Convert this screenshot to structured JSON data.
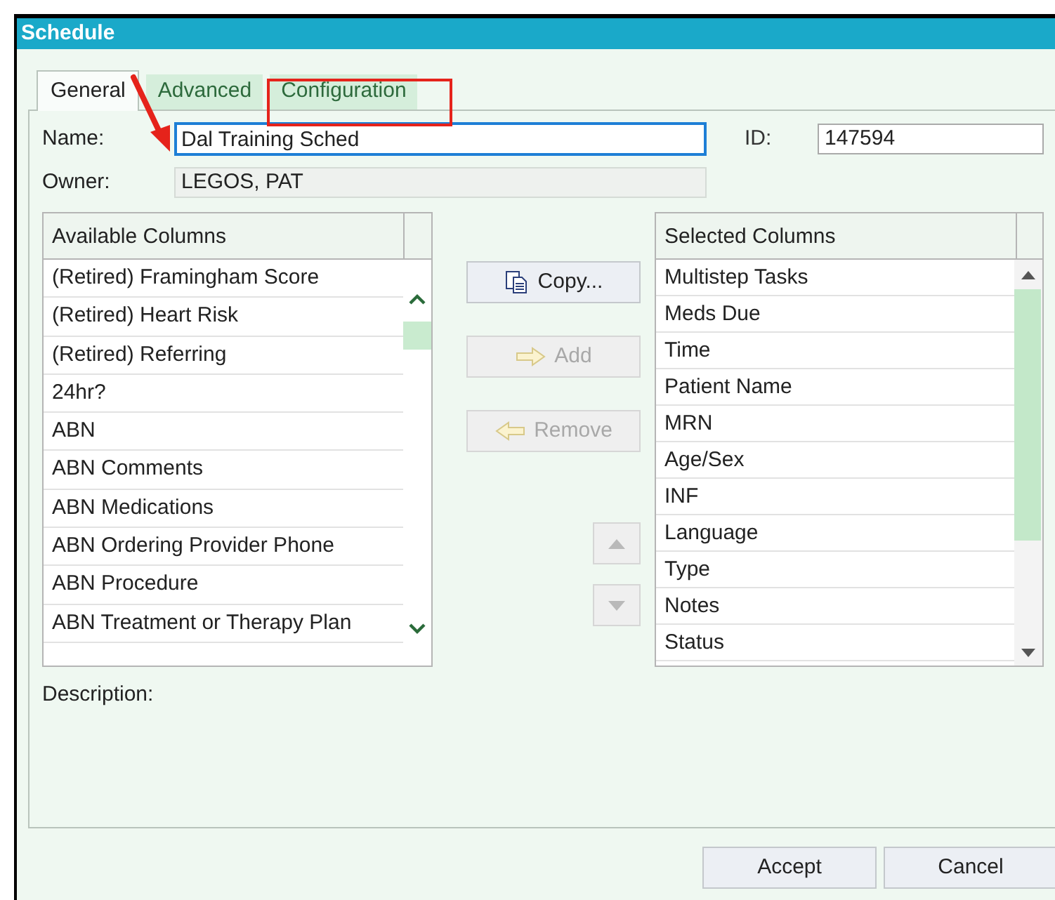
{
  "window": {
    "title": "Schedule"
  },
  "tabs": [
    {
      "label": "General",
      "selected": true
    },
    {
      "label": "Advanced",
      "selected": false
    },
    {
      "label": "Configuration",
      "selected": false
    }
  ],
  "name": {
    "label": "Name:",
    "value": "Dal Training Sched",
    "focused": true
  },
  "id": {
    "label": "ID:",
    "value": "147594"
  },
  "owner": {
    "label": "Owner:",
    "value": "LEGOS, PAT"
  },
  "available_columns": {
    "header": "Available Columns",
    "items": [
      "(Retired) Framingham Score",
      "(Retired) Heart Risk",
      "(Retired) Referring",
      "24hr?",
      "ABN",
      "ABN Comments",
      "ABN Medications",
      "ABN Ordering Provider Phone",
      "ABN Procedure",
      "ABN Treatment or Therapy Plan"
    ]
  },
  "actions": [
    {
      "kind": "copy",
      "label": "Copy...",
      "disabled": false
    },
    {
      "kind": "add",
      "label": "Add",
      "disabled": true
    },
    {
      "kind": "remove",
      "label": "Remove",
      "disabled": true
    }
  ],
  "move_buttons": [
    {
      "kind": "up",
      "disabled": true
    },
    {
      "kind": "down",
      "disabled": true
    }
  ],
  "selected_columns": {
    "header": "Selected Columns",
    "items": [
      "Multistep Tasks",
      "Meds Due",
      "Time",
      "Patient Name",
      "MRN",
      "Age/Sex",
      "INF",
      "Language",
      "Type",
      "Notes",
      "Status"
    ]
  },
  "description": {
    "label": "Description:"
  },
  "footer_buttons": [
    "Accept",
    "Cancel"
  ]
}
